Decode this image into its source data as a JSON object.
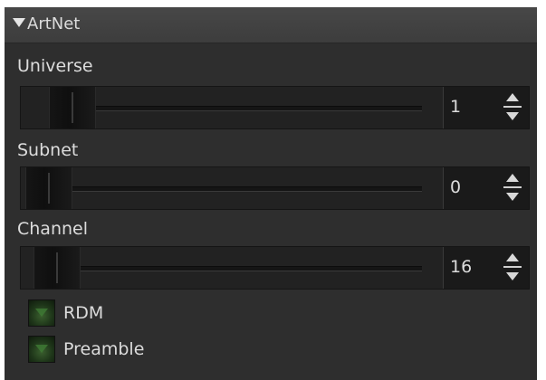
{
  "panel": {
    "title": "ArtNet",
    "expanded": true
  },
  "fields": [
    {
      "label": "Universe",
      "value": "1"
    },
    {
      "label": "Subnet",
      "value": "0"
    },
    {
      "label": "Channel",
      "value": "16"
    }
  ],
  "checkboxes": [
    {
      "label": "RDM",
      "checked": false
    },
    {
      "label": "Preamble",
      "checked": false
    }
  ],
  "colors": {
    "panel_bg": "#2e2e2e",
    "header_bg": "#424242",
    "text": "#dcdcdc",
    "checkbox_green": "#3f7a34"
  },
  "icons": {
    "collapse": "triangle-down-icon",
    "spin": "spin-arrows-icon"
  }
}
